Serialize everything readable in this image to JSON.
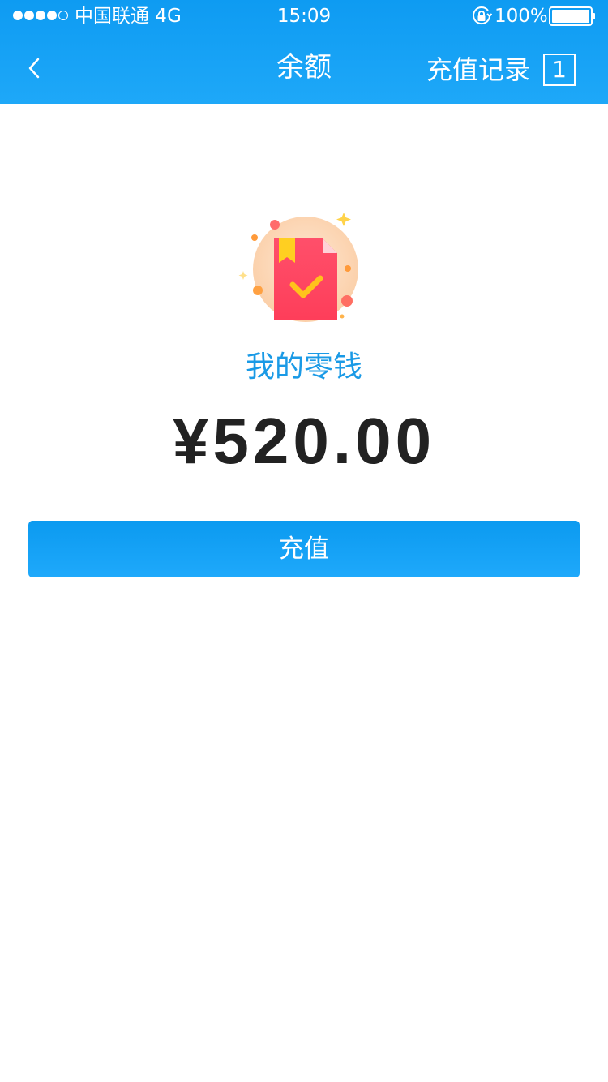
{
  "status_bar": {
    "signal_dots": [
      true,
      true,
      true,
      true,
      false
    ],
    "carrier": "中国联通 4G",
    "time": "15:09",
    "battery_percent": "100%",
    "battery_level": 1.0
  },
  "nav": {
    "back_icon": "chevron-left-icon",
    "title": "余额",
    "records_label": "充值记录",
    "records_badge": "1"
  },
  "wallet": {
    "icon": "wallet-checkmark-icon",
    "label": "我的零钱",
    "amount": "¥520.00"
  },
  "actions": {
    "recharge_label": "充值"
  },
  "colors": {
    "header": "#1ea8f8",
    "accent": "#1a9ae6",
    "button": "#0b9af0",
    "amount_text": "#222222",
    "background": "#ffffff"
  }
}
